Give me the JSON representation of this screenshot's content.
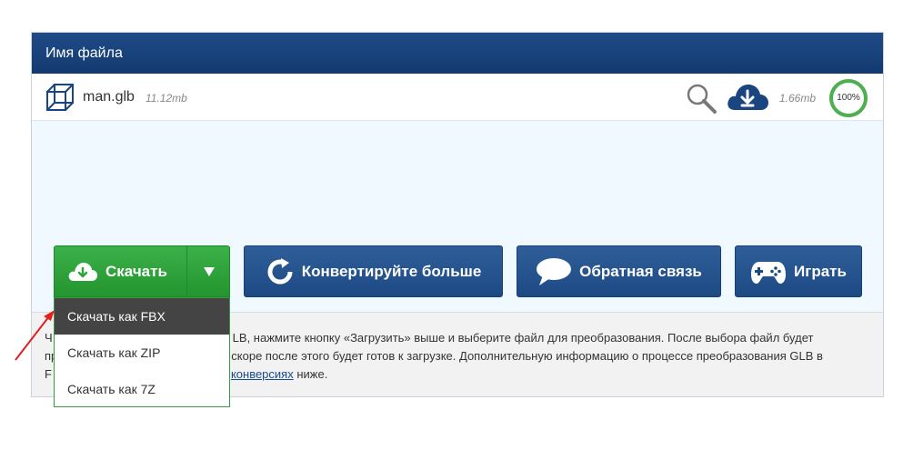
{
  "header": {
    "title": "Имя файла"
  },
  "file": {
    "name": "man.glb",
    "size": "11.12mb",
    "result_size": "1.66mb",
    "progress": "100%",
    "progress_value": 100
  },
  "buttons": {
    "download": "Скачать",
    "convert": "Конвертируйте больше",
    "feedback": "Обратная связь",
    "play": "Играть"
  },
  "dropdown": {
    "items": [
      "Скачать как FBX",
      "Скачать как ZIP",
      "Скачать как 7Z"
    ]
  },
  "info": {
    "line1_start": "Ч",
    "line1_rest": "LB, нажмите кнопку «Загрузить» выше и выберите файл для преобразования. После выбора файл будет",
    "line2_start": "пр",
    "line2_rest": "скоре после этого будет готов к загрузке. Дополнительную информацию о процессе преобразования GLB в",
    "line3_start": "F",
    "line3_link": "конверсиях",
    "line3_rest": " ниже."
  },
  "colors": {
    "header_blue": "#1a4580",
    "download_green": "#2fa33c",
    "progress_green": "#4caf50",
    "cloud_blue": "#1a4580",
    "arrow_red": "#e02020"
  },
  "icons": {
    "file": "cube-icon",
    "search": "magnifier-icon",
    "cloud": "cloud-download-icon",
    "convert": "refresh-icon",
    "feedback": "speech-bubble-icon",
    "play": "gamepad-icon"
  }
}
